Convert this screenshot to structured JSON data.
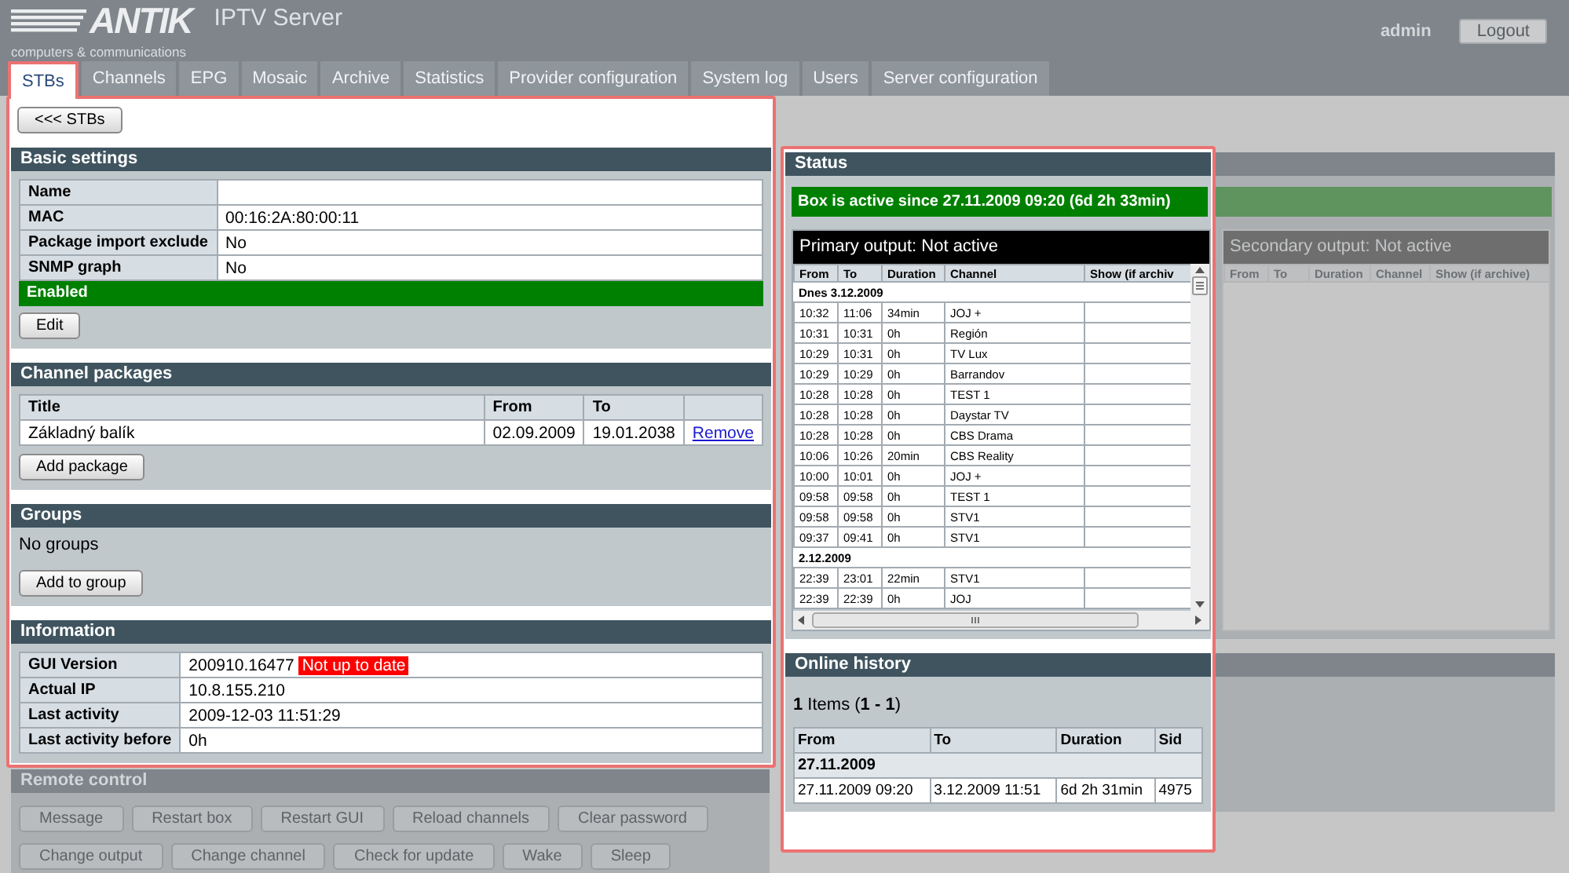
{
  "header": {
    "logo": "ANTIK",
    "tagline": "computers & communications",
    "app_title": "IPTV Server",
    "user": "admin",
    "logout": "Logout"
  },
  "tabs": [
    {
      "label": "STBs",
      "selected": true
    },
    {
      "label": "Channels",
      "selected": false
    },
    {
      "label": "EPG",
      "selected": false
    },
    {
      "label": "Mosaic",
      "selected": false
    },
    {
      "label": "Archive",
      "selected": false
    },
    {
      "label": "Statistics",
      "selected": false
    },
    {
      "label": "Provider configuration",
      "selected": false
    },
    {
      "label": "System log",
      "selected": false
    },
    {
      "label": "Users",
      "selected": false
    },
    {
      "label": "Server configuration",
      "selected": false
    }
  ],
  "back_button": "<<< STBs",
  "basic_settings": {
    "title": "Basic settings",
    "rows": [
      {
        "label": "Name",
        "value": ""
      },
      {
        "label": "MAC",
        "value": "00:16:2A:80:00:11"
      },
      {
        "label": "Package import exclude",
        "value": "No"
      },
      {
        "label": "SNMP graph",
        "value": "No"
      }
    ],
    "state": {
      "label": "Enabled",
      "enabled": true
    },
    "button": "Edit"
  },
  "channel_packages": {
    "title": "Channel packages",
    "columns": [
      "Title",
      "From",
      "To"
    ],
    "rows": [
      {
        "title": "Základný balík",
        "from": "02.09.2009",
        "to": "19.01.2038",
        "action": "Remove"
      }
    ],
    "button": "Add package"
  },
  "groups": {
    "title": "Groups",
    "empty_text": "No groups",
    "button": "Add to group"
  },
  "information": {
    "title": "Information",
    "rows": [
      {
        "label": "GUI Version",
        "value": "200910.16477",
        "badge": "Not up to date"
      },
      {
        "label": "Actual IP",
        "value": "10.8.155.210"
      },
      {
        "label": "Last activity",
        "value": "2009-12-03 11:51:29"
      },
      {
        "label": "Last activity before",
        "value": "0h"
      }
    ]
  },
  "remote_control": {
    "title": "Remote control",
    "dimmed": true,
    "button_rows": [
      [
        "Message",
        "Restart box",
        "Restart GUI",
        "Reload channels",
        "Clear password"
      ],
      [
        "Change output",
        "Change channel",
        "Check for update",
        "Wake",
        "Sleep"
      ]
    ]
  },
  "status": {
    "title": "Status",
    "active_text": "Box is active since 27.11.2009 09:20 (6d 2h 33min)",
    "active": true,
    "primary_output": {
      "title": "Primary output: Not active",
      "dimmed": false,
      "columns": [
        "From",
        "To",
        "Duration",
        "Channel",
        "Show (if archiv"
      ],
      "groups": [
        {
          "date": "Dnes 3.12.2009",
          "rows": [
            {
              "from": "10:32",
              "to": "11:06",
              "duration": "34min",
              "channel": "JOJ +"
            },
            {
              "from": "10:31",
              "to": "10:31",
              "duration": "0h",
              "channel": "Región"
            },
            {
              "from": "10:29",
              "to": "10:31",
              "duration": "0h",
              "channel": "TV Lux"
            },
            {
              "from": "10:29",
              "to": "10:29",
              "duration": "0h",
              "channel": "Barrandov"
            },
            {
              "from": "10:28",
              "to": "10:28",
              "duration": "0h",
              "channel": "TEST 1"
            },
            {
              "from": "10:28",
              "to": "10:28",
              "duration": "0h",
              "channel": "Daystar TV"
            },
            {
              "from": "10:28",
              "to": "10:28",
              "duration": "0h",
              "channel": "CBS Drama"
            },
            {
              "from": "10:06",
              "to": "10:26",
              "duration": "20min",
              "channel": "CBS Reality"
            },
            {
              "from": "10:00",
              "to": "10:01",
              "duration": "0h",
              "channel": "JOJ +"
            },
            {
              "from": "09:58",
              "to": "09:58",
              "duration": "0h",
              "channel": "TEST 1"
            },
            {
              "from": "09:58",
              "to": "09:58",
              "duration": "0h",
              "channel": "STV1"
            },
            {
              "from": "09:37",
              "to": "09:41",
              "duration": "0h",
              "channel": "STV1"
            }
          ]
        },
        {
          "date": "2.12.2009",
          "rows": [
            {
              "from": "22:39",
              "to": "23:01",
              "duration": "22min",
              "channel": "STV1"
            },
            {
              "from": "22:39",
              "to": "22:39",
              "duration": "0h",
              "channel": "JOJ"
            }
          ]
        }
      ]
    },
    "secondary_output": {
      "title": "Secondary output: Not active",
      "dimmed": true,
      "columns": [
        "From",
        "To",
        "Duration",
        "Channel",
        "Show (if archive)"
      ]
    }
  },
  "online_history": {
    "title": "Online history",
    "summary": "**1** Items (**1 - 1**)",
    "columns": [
      "From",
      "To",
      "Duration",
      "Sid"
    ],
    "groups": [
      {
        "date": "27.11.2009",
        "rows": [
          {
            "from": "27.11.2009 09:20",
            "to": "3.12.2009 11:51",
            "duration": "6d 2h 31min",
            "sid": "4975"
          }
        ]
      }
    ]
  }
}
